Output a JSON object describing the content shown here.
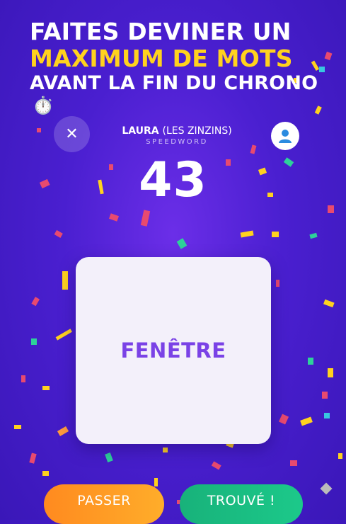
{
  "headline": {
    "line1": "FAITES DEVINER UN",
    "line2": "MAXIMUM DE MOTS",
    "line3": "AVANT LA FIN DU CHRONO",
    "clock_emoji": "⏱️"
  },
  "player": {
    "name": "LAURA",
    "team": "(LES ZINZINS)",
    "mode": "SPEEDWORD"
  },
  "timer": "43",
  "word": "FENÊTRE",
  "buttons": {
    "pass": "PASSER",
    "found": "TROUVÉ !"
  },
  "icons": {
    "close": "close-icon",
    "profile": "user-icon"
  },
  "colors": {
    "accent_yellow": "#ffd21e",
    "word_purple": "#7a42e6",
    "pass_orange": "#ff8a1f",
    "found_green": "#18b27a"
  }
}
